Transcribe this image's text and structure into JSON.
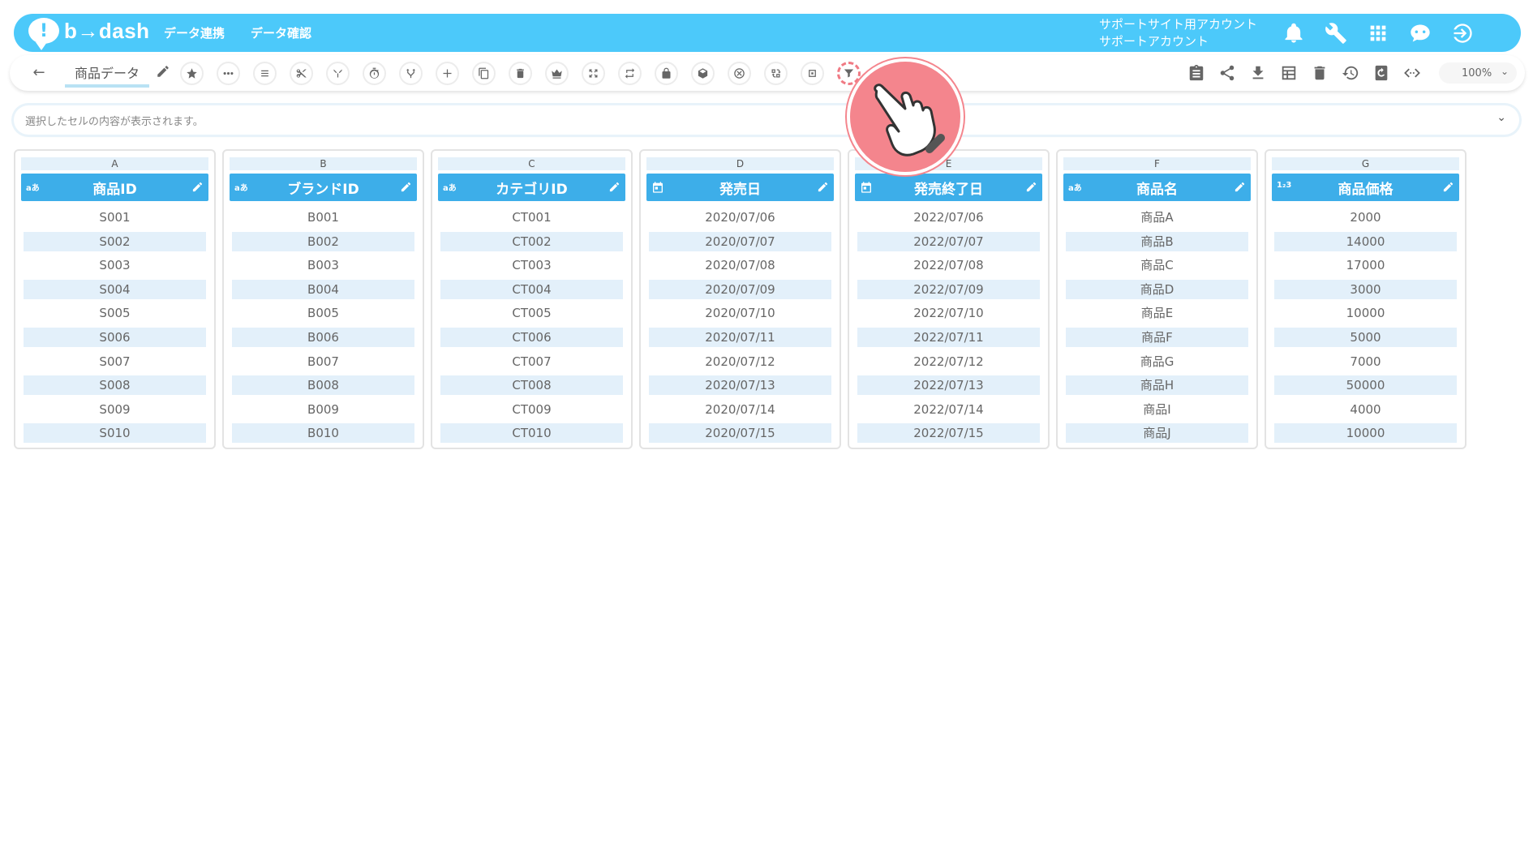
{
  "app": {
    "logo_mark": "!",
    "logo_text": "b→dash",
    "nav": [
      "データ連携",
      "データ確認"
    ],
    "account_line1": "サポートサイト用アカウント",
    "account_line2": "サポートアカウント",
    "top_icons": [
      "bell-icon",
      "wrench-icon",
      "grid-icon",
      "chat-bot-icon",
      "logout-icon"
    ]
  },
  "toolbar": {
    "back": "←",
    "title": "商品データ",
    "tools": [
      "star-icon",
      "more-icon",
      "list-icon",
      "scissors-icon",
      "merge-icon",
      "timer-icon",
      "branch-icon",
      "plus-icon",
      "copy-icon",
      "trash-icon",
      "crown-icon",
      "expand-icon",
      "repeat-icon",
      "lock-icon",
      "box-icon",
      "close-circle-icon",
      "replace-icon",
      "square-icon",
      "filter-icon"
    ],
    "right_tools": [
      "clipboard-icon",
      "share-icon",
      "download-icon",
      "table-icon",
      "delete-icon",
      "history-icon",
      "refresh-icon",
      "code-icon"
    ],
    "zoom": "100%",
    "zoom_chevron": "⌄"
  },
  "cellbar": {
    "placeholder": "選択したセルの内容が表示されます。",
    "chevron": "⌄"
  },
  "columns": [
    {
      "letter": "A",
      "name": "商品ID",
      "type": "text",
      "type_label": "aあ",
      "values": [
        "S001",
        "S002",
        "S003",
        "S004",
        "S005",
        "S006",
        "S007",
        "S008",
        "S009",
        "S010"
      ]
    },
    {
      "letter": "B",
      "name": "ブランドID",
      "type": "text",
      "type_label": "aあ",
      "values": [
        "B001",
        "B002",
        "B003",
        "B004",
        "B005",
        "B006",
        "B007",
        "B008",
        "B009",
        "B010"
      ]
    },
    {
      "letter": "C",
      "name": "カテゴリID",
      "type": "text",
      "type_label": "aあ",
      "values": [
        "CT001",
        "CT002",
        "CT003",
        "CT004",
        "CT005",
        "CT006",
        "CT007",
        "CT008",
        "CT009",
        "CT010"
      ]
    },
    {
      "letter": "D",
      "name": "発売日",
      "type": "date",
      "type_label": "",
      "values": [
        "2020/07/06",
        "2020/07/07",
        "2020/07/08",
        "2020/07/09",
        "2020/07/10",
        "2020/07/11",
        "2020/07/12",
        "2020/07/13",
        "2020/07/14",
        "2020/07/15"
      ]
    },
    {
      "letter": "E",
      "name": "発売終了日",
      "type": "date",
      "type_label": "",
      "values": [
        "2022/07/06",
        "2022/07/07",
        "2022/07/08",
        "2022/07/09",
        "2022/07/10",
        "2022/07/11",
        "2022/07/12",
        "2022/07/13",
        "2022/07/14",
        "2022/07/15"
      ]
    },
    {
      "letter": "F",
      "name": "商品名",
      "type": "text",
      "type_label": "aあ",
      "values": [
        "商品A",
        "商品B",
        "商品C",
        "商品D",
        "商品E",
        "商品F",
        "商品G",
        "商品H",
        "商品I",
        "商品J"
      ]
    },
    {
      "letter": "G",
      "name": "商品価格",
      "type": "number",
      "type_label": "1₂3",
      "values": [
        "2000",
        "14000",
        "17000",
        "3000",
        "10000",
        "5000",
        "7000",
        "50000",
        "4000",
        "10000"
      ]
    }
  ],
  "colors": {
    "brand": "#4cc9fa",
    "header": "#3daee9",
    "row_alt": "#e3f0fa",
    "pointer": "#f4858d"
  }
}
